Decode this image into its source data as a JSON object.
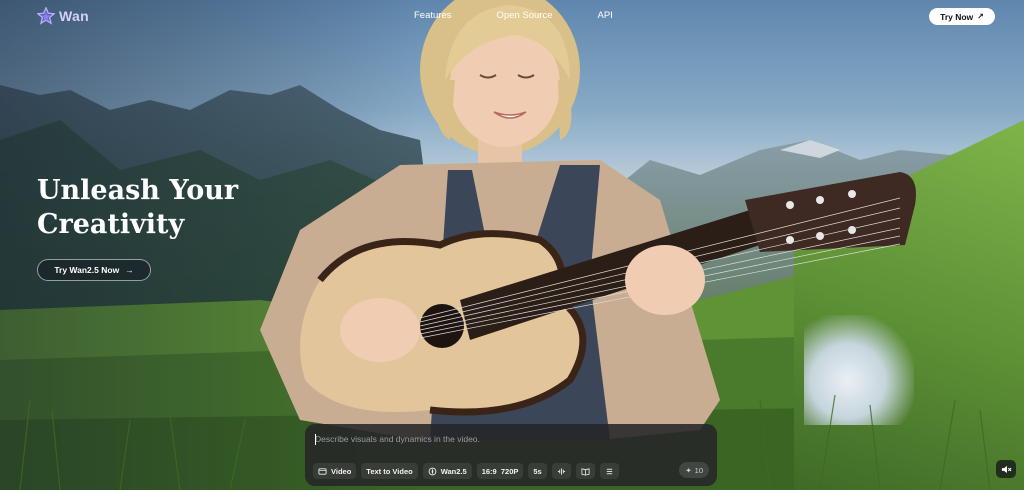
{
  "brand": {
    "name": "Wan",
    "logo_icon": "wan-star-logo-icon",
    "color": "#d6cffb"
  },
  "nav": {
    "links": [
      "Features",
      "Open Source",
      "API"
    ],
    "cta_label": "Try Now",
    "cta_icon": "arrow-up-right-icon"
  },
  "hero": {
    "title_line1": "Unleash Your",
    "title_line2": "Creativity",
    "button_label": "Try Wan2.5 Now",
    "button_icon": "arrow-right-icon"
  },
  "prompt_panel": {
    "placeholder": "Describe visuals and dynamics in the video.",
    "chips": [
      {
        "icon": "video-icon",
        "label": "Video"
      },
      {
        "icon": "",
        "label": "Text to Video"
      },
      {
        "icon": "model-icon",
        "label": "Wan2.5"
      },
      {
        "icon": "",
        "label": "16:9  720P"
      },
      {
        "icon": "",
        "label": "5s"
      },
      {
        "icon": "audio-wave-icon",
        "label": ""
      },
      {
        "icon": "book-icon",
        "label": ""
      },
      {
        "icon": "list-icon",
        "label": ""
      }
    ],
    "credits_icon": "sparkle-icon",
    "credits": "10"
  },
  "sound_icon": "speaker-mute-icon"
}
